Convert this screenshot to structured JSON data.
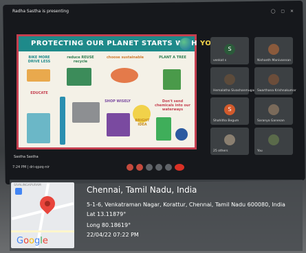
{
  "meeting": {
    "presenting_banner": "Radha Sastha is presenting",
    "speaker_name": "Sastha Sastha",
    "footer_info": "7:24 PM | dri-qpzq-nir",
    "participants": [
      {
        "initial": "S",
        "name": "venkat s",
        "color": "#2b5a3a"
      },
      {
        "initial": "",
        "name": "Nishanth Manivannan",
        "color": "#8a5a3c"
      },
      {
        "initial": "",
        "name": "Hemalatha Sivashanmugam",
        "color": "#5c4b3b"
      },
      {
        "initial": "",
        "name": "Swarthana Krishnakumar",
        "color": "#6b4d3a"
      },
      {
        "initial": "S",
        "name": "Shahitha Begum",
        "color": "#d25a2c"
      },
      {
        "initial": "",
        "name": "Saranya Ganesan",
        "color": "#7a6a5a"
      },
      {
        "initial": "",
        "name": "25 others",
        "color": "#8a7f70"
      },
      {
        "initial": "",
        "name": "You",
        "color": "#5a6a4a"
      }
    ]
  },
  "slide": {
    "title_main": "PROTECTING OUR PLANET STARTS WITH",
    "title_you": "YOU",
    "cells": {
      "bike": "BIKE MORE DRIVE LESS",
      "reduce": "reduce REUSE recycle",
      "veg": "choose sustainable",
      "plant": "PLANT A TREE",
      "educate": "EDUCATE",
      "shop": "SHOP WISELY",
      "chem": "Don't send chemicals into our waterways",
      "bright": "BRIGHT IDEA"
    }
  },
  "geotag": {
    "map_label": "SIVALINGAPURAM",
    "title": "Chennai, Tamil Nadu, India",
    "address": "5-1-6, Venkatraman Nagar, Korattur, Chennai, Tamil Nadu 600080, India",
    "lat": "Lat 13.11879°",
    "long": "Long 80.18619°",
    "datetime": "22/04/22 07:22 PM",
    "google_text": [
      "G",
      "o",
      "o",
      "g",
      "l",
      "e"
    ]
  },
  "colors": {
    "slide_header": "#1e8a8a",
    "slide_border": "#c43f4f",
    "pin": "#e8453c",
    "end_call": "#d93025"
  }
}
